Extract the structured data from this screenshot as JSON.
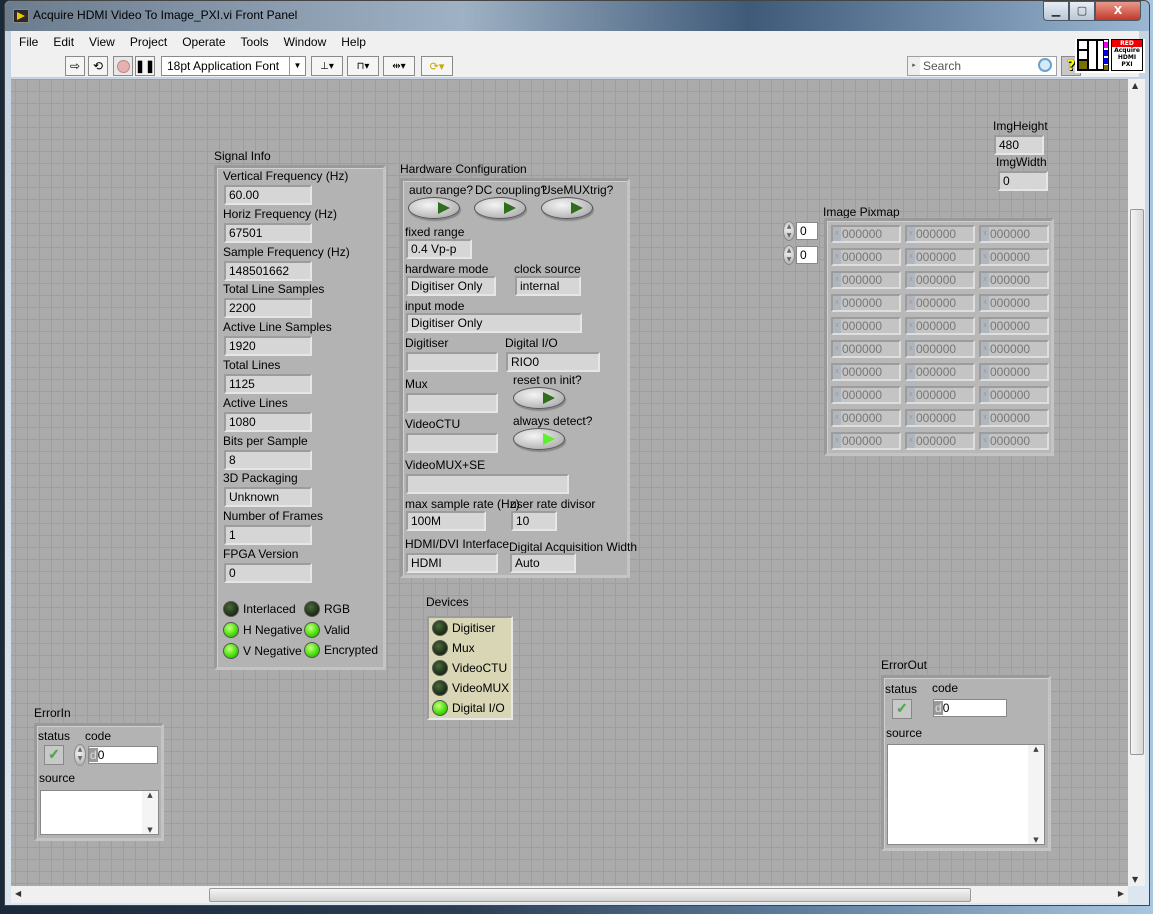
{
  "window": {
    "title": "Acquire HDMI Video To Image_PXI.vi Front Panel",
    "controls": {
      "minimize": "▁",
      "maximize": "▢",
      "close": "X"
    }
  },
  "menubar": [
    "File",
    "Edit",
    "View",
    "Project",
    "Operate",
    "Tools",
    "Window",
    "Help"
  ],
  "toolbar": {
    "run_icon": "run-arrow-icon",
    "run_continuous_icon": "run-continuously-icon",
    "abort_icon": "abort-icon",
    "pause_label": "❚❚",
    "font_select": "18pt Application Font",
    "align_icon": "align-objects-icon",
    "distribute_icon": "distribute-objects-icon",
    "resize_icon": "resize-objects-icon",
    "reorder_icon": "reorder-icon",
    "search_placeholder": "Search",
    "help_label": "?"
  },
  "vi_icon": {
    "line1": "RED",
    "line2": "Acquire",
    "line3": "HDMI",
    "line4": "PXI"
  },
  "signal_info": {
    "title": "Signal Info",
    "fields": [
      {
        "label": "Vertical Frequency (Hz)",
        "value": "60.00"
      },
      {
        "label": "Horiz Frequency (Hz)",
        "value": "67501"
      },
      {
        "label": "Sample Frequency (Hz)",
        "value": "148501662"
      },
      {
        "label": "Total Line Samples",
        "value": "2200"
      },
      {
        "label": "Active Line Samples",
        "value": "1920"
      },
      {
        "label": "Total Lines",
        "value": "1125"
      },
      {
        "label": "Active Lines",
        "value": "1080"
      },
      {
        "label": "Bits per Sample",
        "value": "8"
      },
      {
        "label": "3D Packaging",
        "value": "Unknown"
      },
      {
        "label": "Number of Frames",
        "value": "1"
      },
      {
        "label": "FPGA Version",
        "value": "0"
      }
    ],
    "leds": [
      {
        "label": "Interlaced",
        "on": false
      },
      {
        "label": "RGB",
        "on": false
      },
      {
        "label": "H Negative",
        "on": true
      },
      {
        "label": "Valid",
        "on": true
      },
      {
        "label": "V Negative",
        "on": true
      },
      {
        "label": "Encrypted",
        "on": true
      }
    ]
  },
  "hardware_config": {
    "title": "Hardware Configuration",
    "buttons": [
      {
        "label": "auto range?",
        "on": false
      },
      {
        "label": "DC coupling?",
        "on": false
      },
      {
        "label": "UseMUXtrig?",
        "on": false
      },
      {
        "label": "reset on init?",
        "on": false
      },
      {
        "label": "always detect?",
        "on": true
      }
    ],
    "fixed_range": {
      "label": "fixed range",
      "value": "0.4 Vp-p"
    },
    "hardware_mode": {
      "label": "hardware mode",
      "value": "Digitiser Only"
    },
    "clock_source": {
      "label": "clock source",
      "value": "internal"
    },
    "input_mode": {
      "label": "input mode",
      "value": "Digitiser Only"
    },
    "digitiser": {
      "label": "Digitiser",
      "value": ""
    },
    "digital_io": {
      "label": "Digital I/O",
      "value": "RIO0"
    },
    "mux": {
      "label": "Mux",
      "value": ""
    },
    "videoctu": {
      "label": "VideoCTU",
      "value": ""
    },
    "videomux_se": {
      "label": "VideoMUX+SE",
      "value": ""
    },
    "max_sample_rate": {
      "label": "max sample rate (Hz)",
      "value": "100M"
    },
    "user_rate_divisor": {
      "label": "user rate divisor",
      "value": "10"
    },
    "hdmi_dvi": {
      "label": "HDMI/DVI Interface",
      "value": "HDMI"
    },
    "dig_acq_width": {
      "label": "Digital Acquisition Width",
      "value": "Auto"
    }
  },
  "devices": {
    "title": "Devices",
    "items": [
      {
        "label": "Digitiser",
        "on": false
      },
      {
        "label": "Mux",
        "on": false
      },
      {
        "label": "VideoCTU",
        "on": false
      },
      {
        "label": "VideoMUX",
        "on": false
      },
      {
        "label": "Digital I/O",
        "on": true
      }
    ]
  },
  "img_height": {
    "label": "ImgHeight",
    "value": "480"
  },
  "img_width": {
    "label": "ImgWidth",
    "value": "0"
  },
  "image_pixmap": {
    "title": "Image Pixmap",
    "row_index": "0",
    "col_index": "0",
    "radix": "x",
    "cell_value": "000000",
    "rows": 10,
    "cols": 3
  },
  "error_in": {
    "title": "ErrorIn",
    "status_label": "status",
    "code_label": "code",
    "code_radix": "d",
    "code": "0",
    "source_label": "source",
    "source": "",
    "status_mark": "✓"
  },
  "error_out": {
    "title": "ErrorOut",
    "status_label": "status",
    "code_label": "code",
    "code_radix": "d",
    "code": "0",
    "source_label": "source",
    "source": "",
    "status_mark": "✓"
  }
}
